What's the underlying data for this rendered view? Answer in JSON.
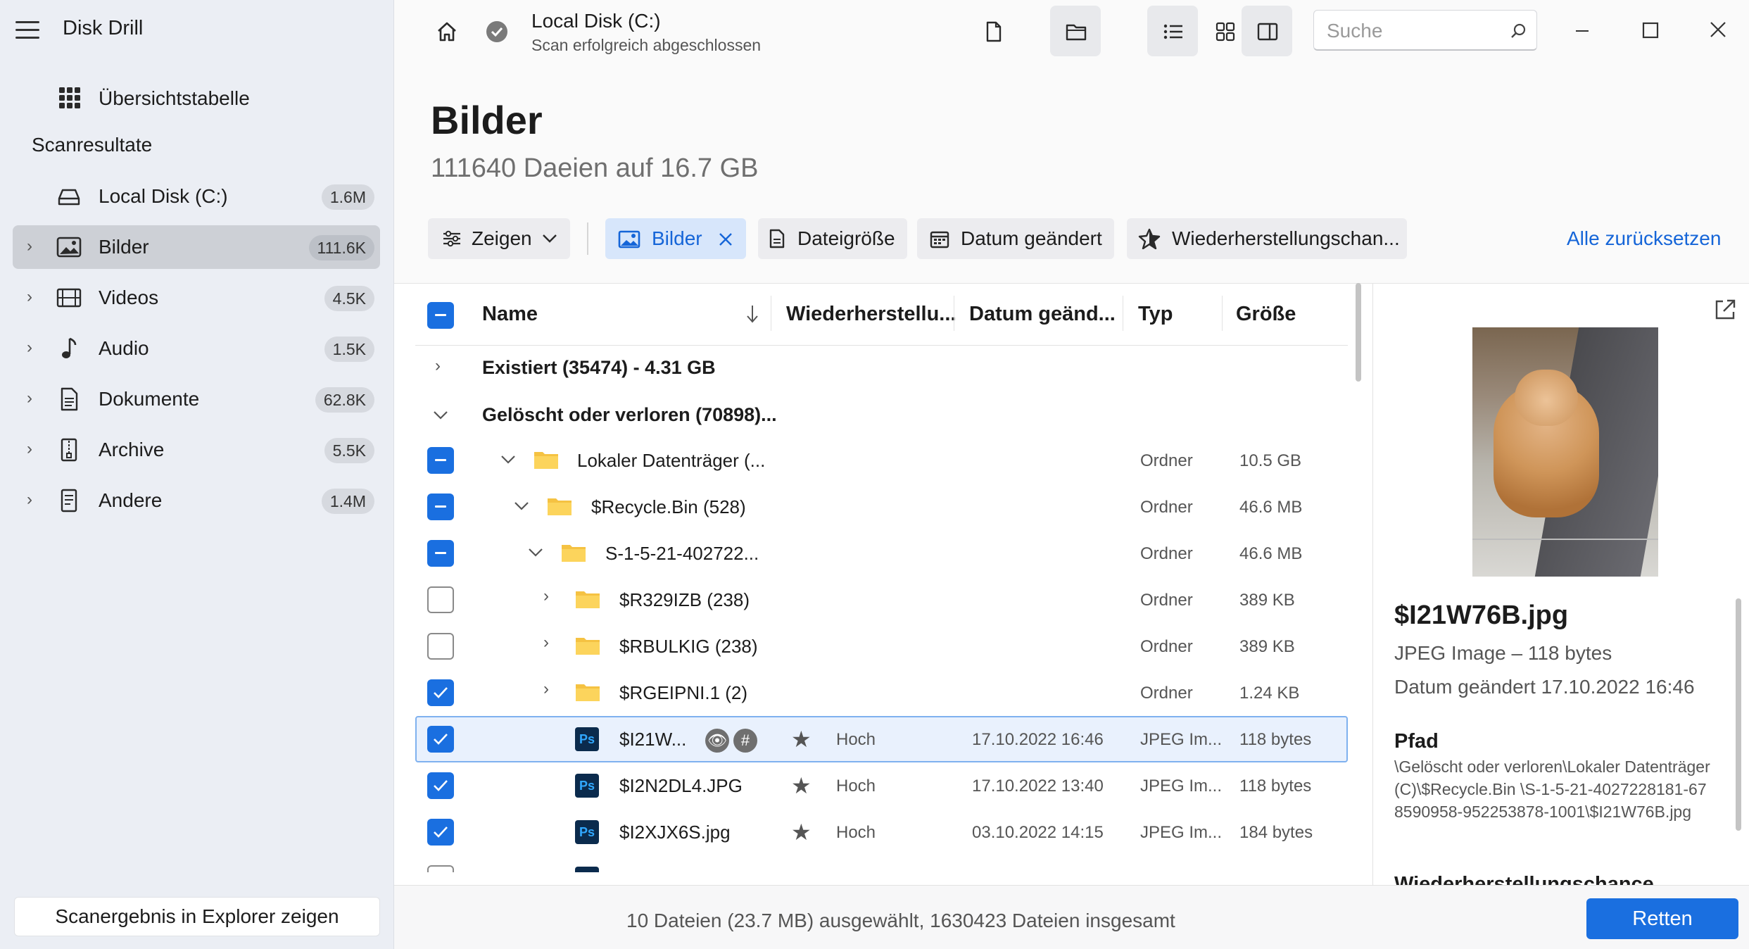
{
  "app": {
    "title": "Disk Drill"
  },
  "sidebar": {
    "overview_label": "Übersichtstabelle",
    "section_label": "Scanresultate",
    "disk": {
      "label": "Local Disk (C:)",
      "badge": "1.6M"
    },
    "items": [
      {
        "label": "Bilder",
        "badge": "111.6K",
        "icon": "image-icon"
      },
      {
        "label": "Videos",
        "badge": "4.5K",
        "icon": "film-icon"
      },
      {
        "label": "Audio",
        "badge": "1.5K",
        "icon": "music-note-icon"
      },
      {
        "label": "Dokumente",
        "badge": "62.8K",
        "icon": "document-icon"
      },
      {
        "label": "Archive",
        "badge": "5.5K",
        "icon": "archive-icon"
      },
      {
        "label": "Andere",
        "badge": "1.4M",
        "icon": "other-file-icon"
      }
    ],
    "footer_button": "Scanergebnis in Explorer zeigen"
  },
  "topbar": {
    "disk_title": "Local Disk (C:)",
    "disk_status": "Scan erfolgreich abgeschlossen",
    "search_placeholder": "Suche"
  },
  "page": {
    "title": "Bilder",
    "subtitle": "111640 Daeien auf 16.7 GB"
  },
  "filters": {
    "show_label": "Zeigen",
    "images_label": "Bilder",
    "size_label": "Dateigröße",
    "date_label": "Datum geändert",
    "chance_label": "Wiederherstellungschan...",
    "reset_label": "Alle zurücksetzen"
  },
  "table": {
    "headers": {
      "name": "Name",
      "recovery": "Wiederherstellu...",
      "date": "Datum geänd...",
      "type": "Typ",
      "size": "Größe"
    },
    "groups": {
      "existing": "Existiert (35474) - 4.31 GB",
      "deleted": "Gelöscht oder verloren (70898)..."
    },
    "rows": [
      {
        "name": "Lokaler Datenträger (...",
        "type": "Ordner",
        "size": "10.5 GB"
      },
      {
        "name": "$Recycle.Bin (528)",
        "type": "Ordner",
        "size": "46.6 MB"
      },
      {
        "name": "S-1-5-21-402722...",
        "type": "Ordner",
        "size": "46.6 MB"
      },
      {
        "name": "$R329IZB (238)",
        "type": "Ordner",
        "size": "389 KB"
      },
      {
        "name": "$RBULKIG (238)",
        "type": "Ordner",
        "size": "389 KB"
      },
      {
        "name": "$RGEIPNI.1 (2)",
        "type": "Ordner",
        "size": "1.24 KB"
      },
      {
        "name": "$I21W...",
        "recovery": "Hoch",
        "date": "17.10.2022 16:46",
        "type": "JPEG Im...",
        "size": "118 bytes"
      },
      {
        "name": "$I2N2DL4.JPG",
        "recovery": "Hoch",
        "date": "17.10.2022 13:40",
        "type": "JPEG Im...",
        "size": "118 bytes"
      },
      {
        "name": "$I2XJX6S.jpg",
        "recovery": "Hoch",
        "date": "03.10.2022 14:15",
        "type": "JPEG Im...",
        "size": "184 bytes"
      }
    ]
  },
  "preview": {
    "file_name": "$I21W76B.jpg",
    "file_type": "JPEG Image – 118 bytes",
    "date": "Datum geändert 17.10.2022 16:46",
    "path_heading": "Pfad",
    "path": "\\Gelöscht oder verloren\\Lokaler Datenträger (C)\\$Recycle.Bin \\S-1-5-21-4027228181-678590958-952253878-1001\\$I21W76B.jpg",
    "next_heading": "Wiederherstellungschance"
  },
  "footer": {
    "status": "10 Dateien (23.7 MB) ausgewählt, 1630423 Dateien insgesamt",
    "recover_label": "Retten"
  },
  "colors": {
    "accent": "#1a6fe0",
    "sidebar_bg": "#ebeef4",
    "selection": "#e9f1fd"
  }
}
